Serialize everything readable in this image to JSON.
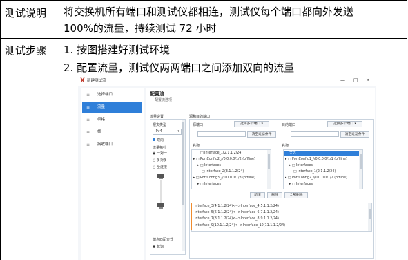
{
  "table": {
    "rows": [
      {
        "label": "测试说明",
        "content_lines": [
          "将交换机所有端口和测试仪都相连，测试仪每个端口都向外发送",
          "100%的流量，持续测试 72 小时"
        ]
      },
      {
        "label": "测试步骤",
        "steps": [
          "1.  按图搭建好测试环境",
          "2.  配置流量，测试仪两两端口之间添加双向的流量"
        ]
      }
    ]
  },
  "screenshot": {
    "logo": "X",
    "app_title": "新建测试流",
    "window_controls": [
      "—",
      "□",
      "✕"
    ],
    "sidebar": [
      {
        "label": "选择端口",
        "icon": "≡",
        "active": false
      },
      {
        "label": "流量",
        "icon": "≡",
        "active": true
      },
      {
        "label": "帧格",
        "icon": "≡",
        "active": false
      },
      {
        "label": "帧",
        "icon": "≡",
        "active": false
      },
      {
        "label": "接收端口",
        "icon": "≡",
        "active": false
      }
    ],
    "main_title": "配置流",
    "main_subtitle": "配置流选项",
    "flow_settings": {
      "title": "流量设置",
      "traffic_type_label": "报文类型",
      "traffic_type_value": "IPv4",
      "bidirectional_label": "双向",
      "topology_label": "流量拓扑",
      "topology_options": [
        "一对一",
        "多对多",
        "全连接"
      ],
      "distribution_label": "端点匹配方式",
      "distribution_option": "轮询"
    },
    "port_select": {
      "title": "源和目的端口",
      "source_label": "源端口",
      "dest_label": "目的端口",
      "multi_select": "选择多个端口",
      "clear_filter": "清空过滤条件",
      "name_header": "名称",
      "source_tree": [
        "□ Interface_1(2.1.1.2/24)",
        "▸ □ PortConfig2_//0.0.0.0/1/2 (offline)",
        "▸ □ Interfaces",
        "□ Interface_2(3.1.1.2/24)",
        "▸ □ PortConfig3_//0.0.0.0/1/3 (offline)",
        "▸ □ Interfaces"
      ],
      "dest_tree": [
        "全选",
        "▸ □ PortConfig1_//0.0.0.0/1/1 (offline)",
        "▸ □ Interfaces",
        "□ Interface_1(2.1.1.2/24)",
        "▸ □ PortConfig2_//0.0.0.0/1/2 (offline)",
        "▸ □ Interfaces"
      ],
      "new_button": "新增",
      "delete_button": "删除",
      "delete_all_button": "全部删除"
    },
    "results": [
      "Interface_3(4.1.1.2/24)<-->Interface_4(5.1.1.2/24)",
      "Interface_5(6.1.1.2/24)<-->Interface_6(7.1.1.2/24)",
      "Interface_7(8.1.1.2/24)<-->Interface_8(9.1.1.2/24)",
      "Interface_9(10.1.1.2/24)<-->Interface_10(11.1.1.2/24)"
    ]
  }
}
